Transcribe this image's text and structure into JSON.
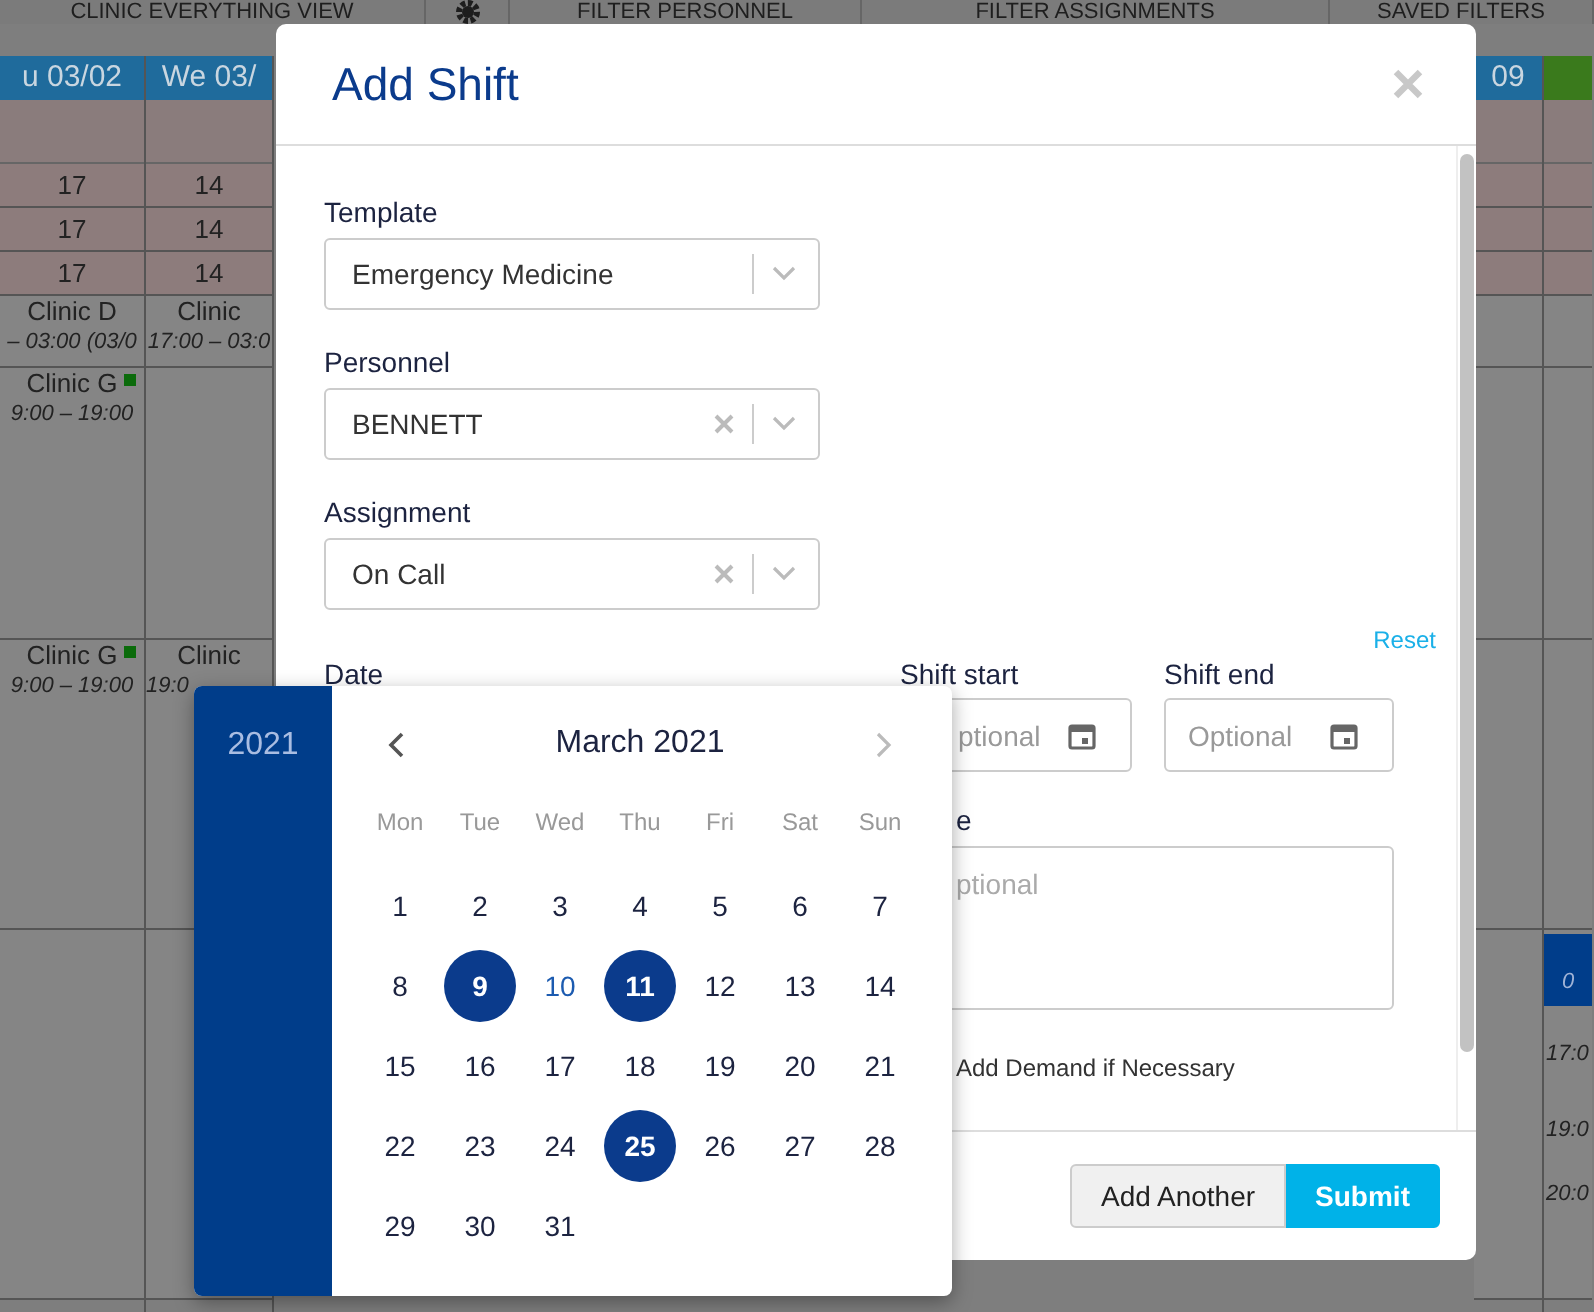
{
  "toolbar": {
    "view": "CLINIC EVERYTHING VIEW",
    "buttons": [
      "FILTER PERSONNEL",
      "FILTER ASSIGNMENTS",
      "SAVED FILTERS"
    ]
  },
  "schedule": {
    "columns": [
      {
        "header": "u 03/02",
        "counts": [
          "17",
          "17",
          "17"
        ],
        "cells": [
          {
            "kind": "shift",
            "title": "Clinic D",
            "time": "– 03:00 (03/0",
            "marked": false
          },
          {
            "kind": "shift",
            "title": "Clinic G",
            "time": "9:00 – 19:00",
            "marked": true
          },
          {
            "kind": "shift",
            "title": "Clinic G",
            "time": "9:00 – 19:00",
            "marked": true
          },
          {
            "kind": "empty"
          }
        ]
      },
      {
        "header": "We 03/",
        "counts": [
          "14",
          "14",
          "14"
        ],
        "cells": [
          {
            "kind": "shift",
            "title": "Clinic",
            "time": "17:00 – 03:0",
            "marked": false
          },
          {
            "kind": "empty"
          },
          {
            "kind": "shift",
            "title": "Clinic",
            "time": "19:0",
            "marked": false
          },
          {
            "kind": "empty"
          }
        ]
      }
    ],
    "right": {
      "header": "09",
      "bar": "0",
      "times": [
        "17:0",
        "19:0",
        "20:0"
      ]
    }
  },
  "dialog": {
    "title": "Add Shift",
    "selects": [
      {
        "label": "Template",
        "value": "Emergency Medicine",
        "clearable": false
      },
      {
        "label": "Personnel",
        "value": "BENNETT",
        "clearable": true
      },
      {
        "label": "Assignment",
        "value": "On Call",
        "clearable": true
      }
    ],
    "reset": "Reset",
    "date_label": "Date",
    "shift_start": {
      "label": "Shift start",
      "placeholder": "ptional"
    },
    "shift_end": {
      "label": "Shift end",
      "placeholder": "Optional"
    },
    "note": {
      "label": "e",
      "placeholder": "ptional"
    },
    "demand_label": "Add Demand if Necessary",
    "buttons": [
      {
        "label": "Add Another",
        "kind": "secondary"
      },
      {
        "label": "Submit",
        "kind": "primary"
      }
    ]
  },
  "datepicker": {
    "year": "2021",
    "month": "March 2021",
    "weekdays": [
      "Mon",
      "Tue",
      "Wed",
      "Thu",
      "Fri",
      "Sat",
      "Sun"
    ],
    "days": [
      {
        "label": "1",
        "selected": false,
        "today": false
      },
      {
        "label": "2",
        "selected": false,
        "today": false
      },
      {
        "label": "3",
        "selected": false,
        "today": false
      },
      {
        "label": "4",
        "selected": false,
        "today": false
      },
      {
        "label": "5",
        "selected": false,
        "today": false
      },
      {
        "label": "6",
        "selected": false,
        "today": false
      },
      {
        "label": "7",
        "selected": false,
        "today": false
      },
      {
        "label": "8",
        "selected": false,
        "today": false
      },
      {
        "label": "9",
        "selected": true,
        "today": false
      },
      {
        "label": "10",
        "selected": false,
        "today": true
      },
      {
        "label": "11",
        "selected": true,
        "today": false
      },
      {
        "label": "12",
        "selected": false,
        "today": false
      },
      {
        "label": "13",
        "selected": false,
        "today": false
      },
      {
        "label": "14",
        "selected": false,
        "today": false
      },
      {
        "label": "15",
        "selected": false,
        "today": false
      },
      {
        "label": "16",
        "selected": false,
        "today": false
      },
      {
        "label": "17",
        "selected": false,
        "today": false
      },
      {
        "label": "18",
        "selected": false,
        "today": false
      },
      {
        "label": "19",
        "selected": false,
        "today": false
      },
      {
        "label": "20",
        "selected": false,
        "today": false
      },
      {
        "label": "21",
        "selected": false,
        "today": false
      },
      {
        "label": "22",
        "selected": false,
        "today": false
      },
      {
        "label": "23",
        "selected": false,
        "today": false
      },
      {
        "label": "24",
        "selected": false,
        "today": false
      },
      {
        "label": "25",
        "selected": true,
        "today": false
      },
      {
        "label": "26",
        "selected": false,
        "today": false
      },
      {
        "label": "27",
        "selected": false,
        "today": false
      },
      {
        "label": "28",
        "selected": false,
        "today": false
      },
      {
        "label": "29",
        "selected": false,
        "today": false
      },
      {
        "label": "30",
        "selected": false,
        "today": false
      },
      {
        "label": "31",
        "selected": false,
        "today": false
      }
    ]
  }
}
